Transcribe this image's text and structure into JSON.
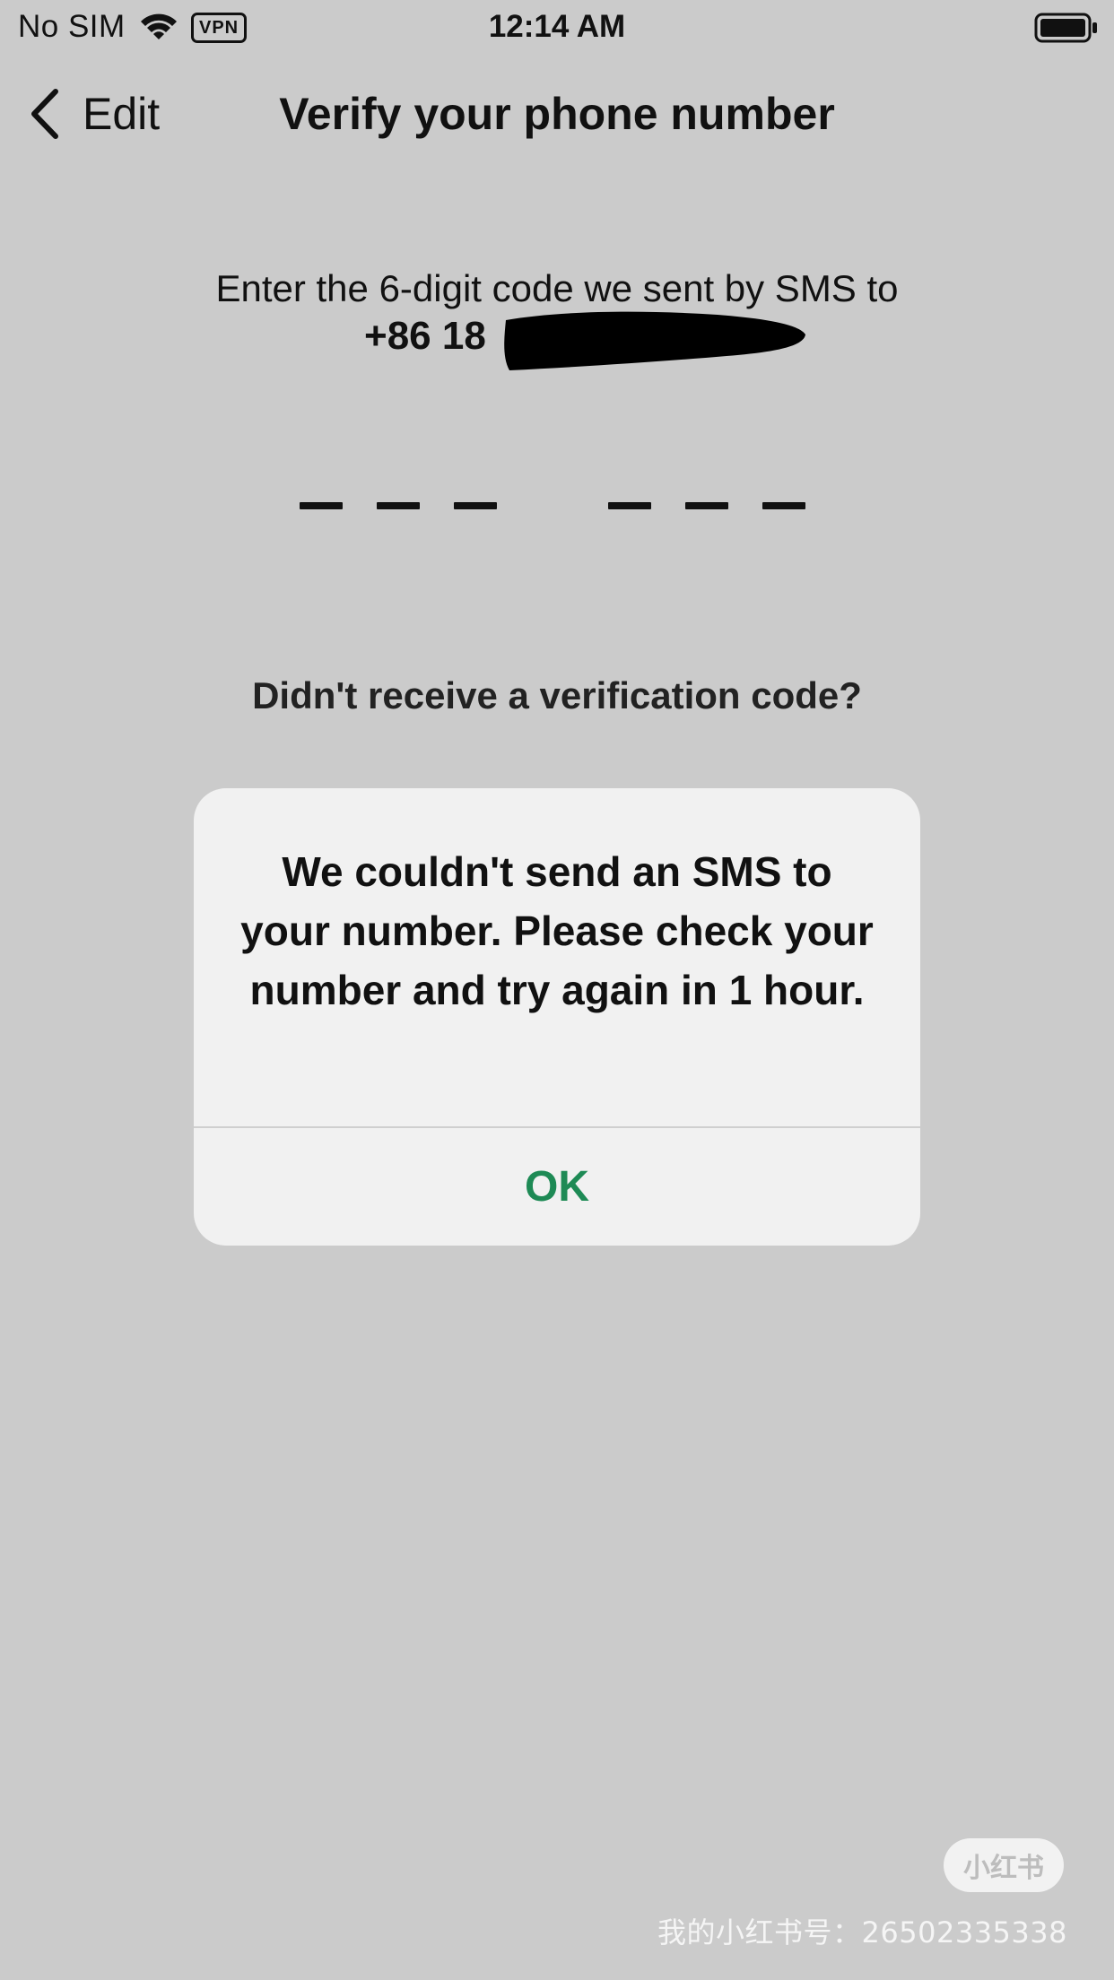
{
  "status_bar": {
    "carrier": "No SIM",
    "wifi_icon": "wifi-icon",
    "vpn_label": "VPN",
    "time": "12:14 AM",
    "battery_icon": "battery-full-icon"
  },
  "nav": {
    "back_icon": "chevron-left-icon",
    "back_label": "Edit",
    "title": "Verify your phone number"
  },
  "verification": {
    "instructions": "Enter the 6-digit code we sent by SMS to",
    "phone_visible": "+86 18",
    "code_length": 6,
    "resend_prompt": "Didn't receive a verification code?"
  },
  "alert": {
    "message": "We couldn't send an SMS to your number. Please check your number and try again in 1 hour.",
    "ok_label": "OK"
  },
  "watermark": {
    "badge": "小红书",
    "text": "我的小红书号：26502335338"
  },
  "colors": {
    "background": "#cbcbcb",
    "alert_background": "#f1f1f1",
    "accent": "#1e8a55",
    "text": "#111111"
  }
}
